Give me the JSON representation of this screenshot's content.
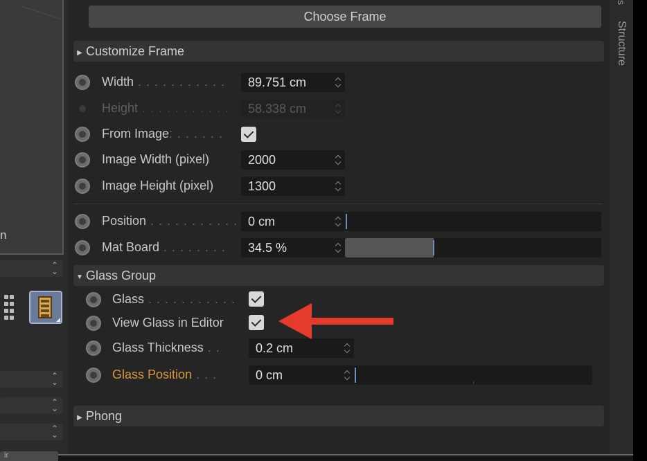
{
  "left_panel": {
    "viewport_fragment": "n",
    "bottom_tab_fragment": "ir"
  },
  "top_button": {
    "label": "Choose Frame"
  },
  "sections": {
    "customize_frame": {
      "title": "Customize Frame",
      "expanded": false
    },
    "glass_group": {
      "title": "Glass Group",
      "expanded": true
    },
    "phong": {
      "title": "Phong",
      "expanded": false
    }
  },
  "rows": {
    "width": {
      "label": "Width",
      "dots": " . . . . . . . . . . .",
      "value": "89.751 cm"
    },
    "height": {
      "label": "Height",
      "dots": " . . . . . . . . . . .",
      "value": "58.338 cm",
      "disabled": true
    },
    "from_image": {
      "label": "From Image",
      "dots": ": . . . . . .",
      "checked": true
    },
    "image_width": {
      "label": "Image Width (pixel)",
      "value": "2000"
    },
    "image_height": {
      "label": "Image Height (pixel)",
      "value": "1300"
    },
    "position": {
      "label": "Position",
      "dots": " . . . . . . . . . . .",
      "value": "0 cm",
      "slider_fraction": 0.0
    },
    "mat_board": {
      "label": "Mat Board",
      "dots": " . . . . . . . .",
      "value": "34.5 %",
      "slider_fraction": 0.345
    },
    "glass": {
      "label": "Glass",
      "dots": " . . . . . . . . . . .",
      "checked": true
    },
    "view_glass": {
      "label": "View Glass in Editor",
      "checked": true
    },
    "glass_thickness": {
      "label": "Glass Thickness",
      "dots": " . .",
      "value": "0.2 cm"
    },
    "glass_position": {
      "label": "Glass Position",
      "dots": " . . .",
      "value": "0 cm",
      "slider_fraction": 0.0
    }
  },
  "sidebar": {
    "structure_tab": "Structure",
    "top_tab": "s"
  },
  "colors": {
    "highlight_label": "#d9973c",
    "annotation_arrow": "#e53b2c",
    "slider_thumb": "#6f8fb8"
  },
  "icons": [
    "radio-icon",
    "checkbox-icon",
    "spin-arrows-icon",
    "expand-triangle-icon",
    "grid-icon",
    "film-strip-icon",
    "annotation-arrow-icon"
  ]
}
